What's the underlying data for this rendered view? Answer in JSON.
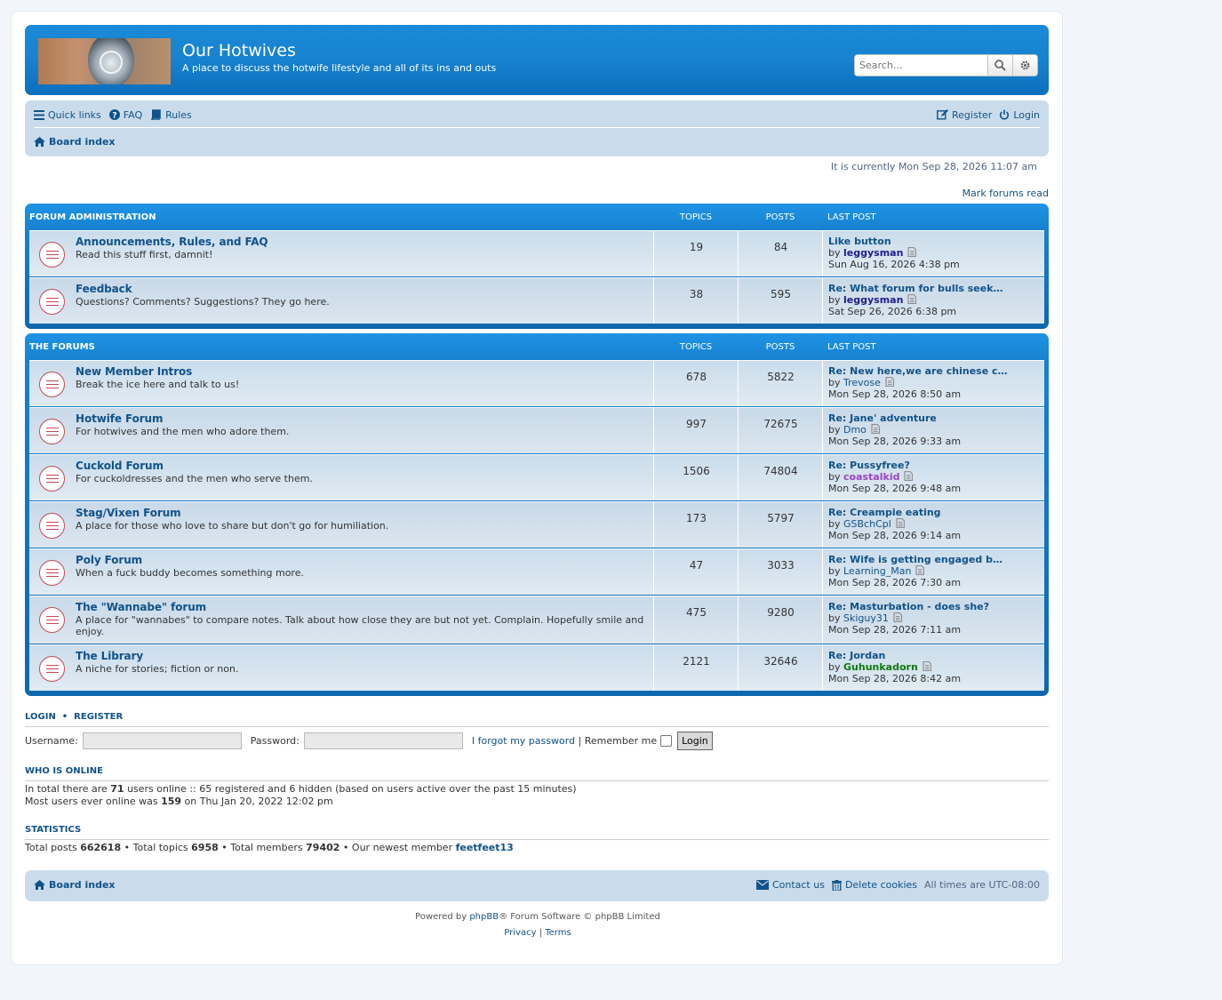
{
  "header": {
    "site_title": "Our Hotwives",
    "site_description": "A place to discuss the hotwife lifestyle and all of its ins and outs",
    "search_placeholder": "Search…"
  },
  "nav": {
    "quick_links": "Quick links",
    "faq": "FAQ",
    "rules": "Rules",
    "register": "Register",
    "login": "Login",
    "board_index": "Board index"
  },
  "current_time": "It is currently Mon Sep 28, 2026 11:07 am",
  "mark_read": "Mark forums read",
  "categories": [
    {
      "title": "Forum Administration",
      "col_topics": "Topics",
      "col_posts": "Posts",
      "col_last": "Last post",
      "forums": [
        {
          "name": "Announcements, Rules, and FAQ",
          "desc": "Read this stuff first, damnit!",
          "topics": "19",
          "posts": "84",
          "last_title": "Like button",
          "by": "by",
          "user": "leggysman",
          "user_color": "#1e1e8c",
          "user_bold": true,
          "date": "Sun Aug 16, 2026 4:38 pm"
        },
        {
          "name": "Feedback",
          "desc": "Questions? Comments? Suggestions? They go here.",
          "topics": "38",
          "posts": "595",
          "last_title": "Re: What forum for bulls seek…",
          "by": "by",
          "user": "leggysman",
          "user_color": "#1e1e8c",
          "user_bold": true,
          "date": "Sat Sep 26, 2026 6:38 pm"
        }
      ]
    },
    {
      "title": "The Forums",
      "col_topics": "Topics",
      "col_posts": "Posts",
      "col_last": "Last post",
      "forums": [
        {
          "name": "New Member Intros",
          "desc": "Break the ice here and talk to us!",
          "topics": "678",
          "posts": "5822",
          "last_title": "Re: New here,we are chinese c…",
          "by": "by",
          "user": "Trevose",
          "user_color": "#105289",
          "user_bold": false,
          "date": "Mon Sep 28, 2026 8:50 am"
        },
        {
          "name": "Hotwife Forum",
          "desc": "For hotwives and the men who adore them.",
          "topics": "997",
          "posts": "72675",
          "last_title": "Re: Jane' adventure",
          "by": "by",
          "user": "Dmo",
          "user_color": "#105289",
          "user_bold": false,
          "date": "Mon Sep 28, 2026 9:33 am"
        },
        {
          "name": "Cuckold Forum",
          "desc": "For cuckoldresses and the men who serve them.",
          "topics": "1506",
          "posts": "74804",
          "last_title": "Re: Pussyfree?",
          "by": "by",
          "user": "coastalkid",
          "user_color": "#9b44c2",
          "user_bold": true,
          "date": "Mon Sep 28, 2026 9:48 am"
        },
        {
          "name": "Stag/Vixen Forum",
          "desc": "A place for those who love to share but don't go for humiliation.",
          "topics": "173",
          "posts": "5797",
          "last_title": "Re: Creampie eating",
          "by": "by",
          "user": "GSBchCpl",
          "user_color": "#105289",
          "user_bold": false,
          "date": "Mon Sep 28, 2026 9:14 am"
        },
        {
          "name": "Poly Forum",
          "desc": "When a fuck buddy becomes something more.",
          "topics": "47",
          "posts": "3033",
          "last_title": "Re: Wife is getting engaged b…",
          "by": "by",
          "user": "Learning_Man",
          "user_color": "#105289",
          "user_bold": false,
          "date": "Mon Sep 28, 2026 7:30 am"
        },
        {
          "name": "The \"Wannabe\" forum",
          "desc": "A place for \"wannabes\" to compare notes. Talk about how close they are but not yet. Complain. Hopefully smile and enjoy.",
          "topics": "475",
          "posts": "9280",
          "last_title": "Re: Masturbation - does she?",
          "by": "by",
          "user": "Skiguy31",
          "user_color": "#105289",
          "user_bold": false,
          "date": "Mon Sep 28, 2026 7:11 am"
        },
        {
          "name": "The Library",
          "desc": "A niche for stories; fiction or non.",
          "topics": "2121",
          "posts": "32646",
          "last_title": "Re: Jordan",
          "by": "by",
          "user": "Guhunkadorn",
          "user_color": "#0d7a0d",
          "user_bold": true,
          "date": "Mon Sep 28, 2026 8:42 am"
        }
      ]
    }
  ],
  "login_box": {
    "title_login": "Login",
    "title_register": "Register",
    "username_label": "Username:",
    "password_label": "Password:",
    "forgot": "I forgot my password",
    "remember": "Remember me",
    "login_btn": "Login"
  },
  "who_online": {
    "title": "Who is online",
    "line1_pre": "In total there are",
    "line1_num": "71",
    "line1_post": "users online :: 65 registered and 6 hidden (based on users active over the past 15 minutes)",
    "line2_pre": "Most users ever online was",
    "line2_num": "159",
    "line2_post": "on Thu Jan 20, 2022 12:02 pm"
  },
  "stats": {
    "title": "Statistics",
    "posts_label": "Total posts",
    "posts": "662618",
    "topics_label": "Total topics",
    "topics": "6958",
    "members_label": "Total members",
    "members": "79402",
    "newest_label": "Our newest member",
    "newest": "feetfeet13"
  },
  "footer": {
    "board_index": "Board index",
    "contact": "Contact us",
    "cookies": "Delete cookies",
    "timezone": "All times are UTC-08:00",
    "powered_pre": "Powered by",
    "phpbb": "phpBB",
    "powered_post": "® Forum Software © phpBB Limited",
    "privacy": "Privacy",
    "terms": "Terms"
  }
}
